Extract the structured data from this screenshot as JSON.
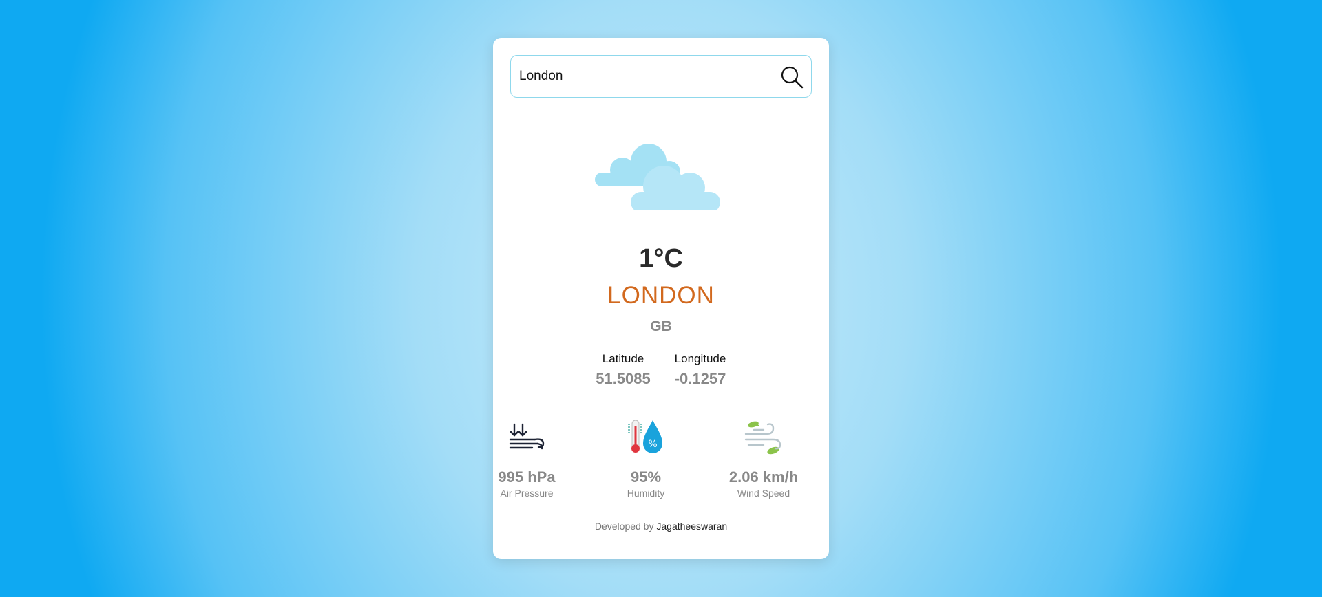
{
  "search": {
    "value": "London",
    "icon": "search-icon"
  },
  "weather": {
    "icon": "clouds-icon",
    "temperature": "1°C",
    "city": "LONDON",
    "country": "GB"
  },
  "coordinates": {
    "latitude_label": "Latitude",
    "latitude_value": "51.5085",
    "longitude_label": "Longitude",
    "longitude_value": "-0.1257"
  },
  "stats": {
    "pressure": {
      "value": "995 hPa",
      "label": "Air Pressure",
      "icon": "air-pressure-icon"
    },
    "humidity": {
      "value": "95%",
      "label": "Humidity",
      "icon": "humidity-icon"
    },
    "wind": {
      "value": "2.06 km/h",
      "label": "Wind Speed",
      "icon": "wind-icon"
    }
  },
  "footer": {
    "prefix": "Developed by",
    "developer": "Jagatheeswaran"
  },
  "colors": {
    "city": "#d2691e",
    "search_border": "#8fd8ec",
    "cloud_back": "#a4e1f4",
    "cloud_front": "#b5e6f7"
  }
}
